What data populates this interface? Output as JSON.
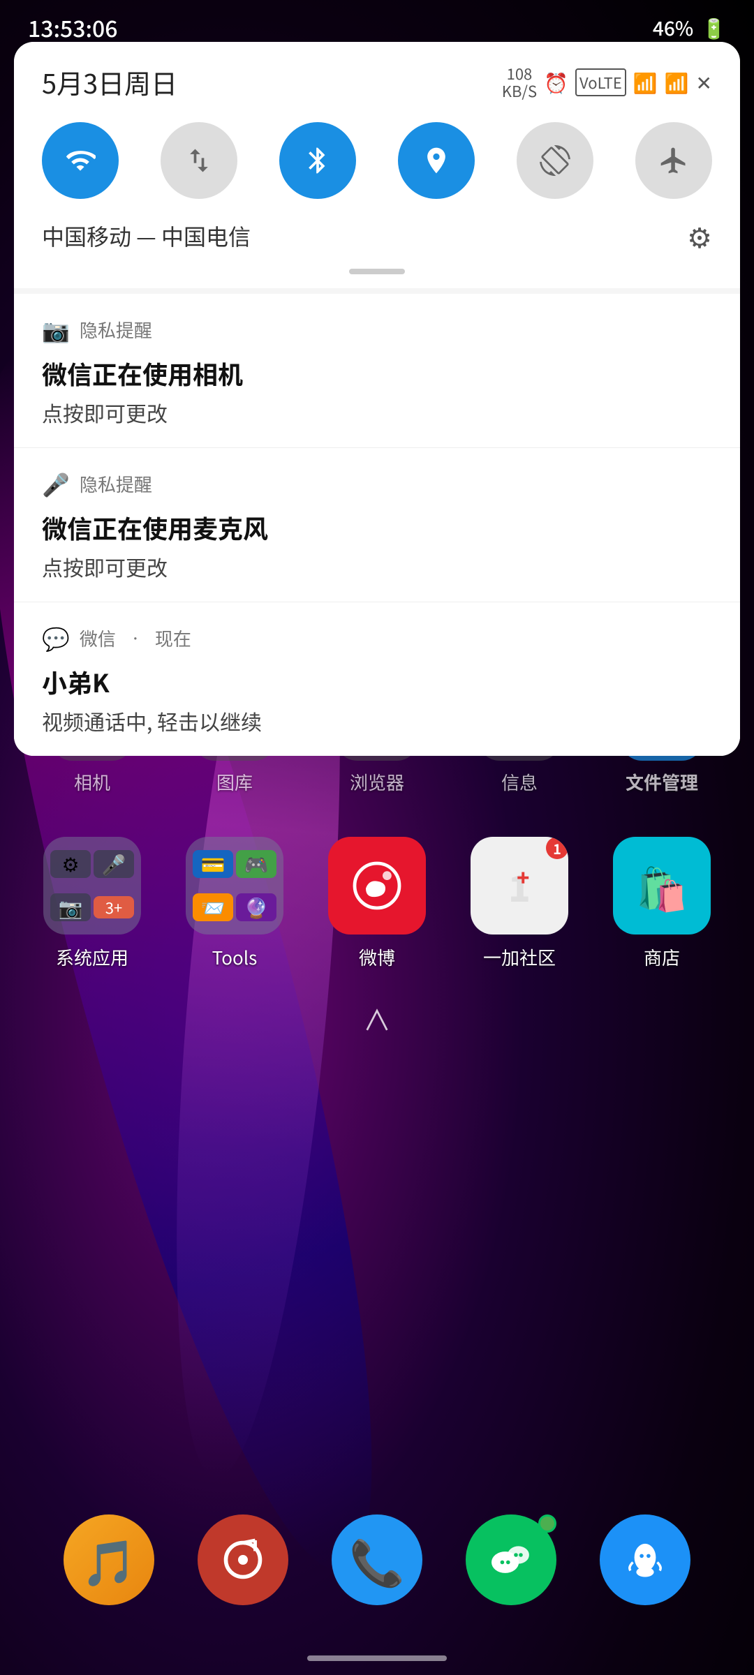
{
  "statusBar": {
    "time": "13:53:06",
    "battery": "46%",
    "batteryIcon": "🔋"
  },
  "quickSettings": {
    "date": "5月3日周日",
    "networkSpeed": "108\nKB/S",
    "toggles": [
      {
        "id": "wifi",
        "icon": "wifi",
        "active": true
      },
      {
        "id": "data",
        "icon": "data",
        "active": false
      },
      {
        "id": "bluetooth",
        "icon": "bluetooth",
        "active": true
      },
      {
        "id": "location",
        "icon": "location",
        "active": true
      },
      {
        "id": "rotation",
        "icon": "rotation",
        "active": false
      },
      {
        "id": "airplane",
        "icon": "airplane",
        "active": false
      }
    ],
    "networkLabel": "中国移动 — 中国电信",
    "settingsLabel": "⚙"
  },
  "notifications": [
    {
      "id": "camera-privacy",
      "iconType": "camera",
      "source": "隐私提醒",
      "title": "微信正在使用相机",
      "body": "点按即可更改"
    },
    {
      "id": "mic-privacy",
      "iconType": "mic",
      "source": "隐私提醒",
      "title": "微信正在使用麦克风",
      "body": "点按即可更改"
    },
    {
      "id": "wechat-call",
      "iconType": "wechat",
      "source": "微信",
      "dot": "•",
      "time": "现在",
      "title": "小弟K",
      "body": "视频通话中, 轻击以继续"
    }
  ],
  "homescreen": {
    "topApps": [
      {
        "label": "相机",
        "icon": "📷",
        "bg": "#555"
      },
      {
        "label": "图库",
        "icon": "🖼️",
        "bg": "#555"
      },
      {
        "label": "浏览器",
        "icon": "🌐",
        "bg": "#555"
      },
      {
        "label": "信息",
        "icon": "💬",
        "bg": "#555"
      },
      {
        "label": "文件管理",
        "bold": true,
        "icon": "📁",
        "bg": "#1a8fe3"
      }
    ],
    "folderApps": [
      {
        "label": "系统应用",
        "isFolder": true
      },
      {
        "label": "Tools",
        "isFolder": true
      },
      {
        "label": "微博",
        "icon": "微博",
        "bg": "#e6162d"
      },
      {
        "label": "一加社区",
        "icon": "1+",
        "bg": "#e0e0e0"
      },
      {
        "label": "商店",
        "icon": "🛍️",
        "bg": "#00bcd4"
      }
    ],
    "bottomApps": [
      {
        "label": "音乐",
        "icon": "🎵",
        "bg": "#f5a623"
      },
      {
        "label": "网易云",
        "icon": "♥",
        "bg": "#c0392b"
      },
      {
        "label": "电话",
        "icon": "📞",
        "bg": "#2196f3"
      },
      {
        "label": "微信",
        "icon": "💬",
        "bg": "#07c160"
      },
      {
        "label": "QQ",
        "icon": "🐧",
        "bg": "#1c91f7"
      }
    ]
  }
}
